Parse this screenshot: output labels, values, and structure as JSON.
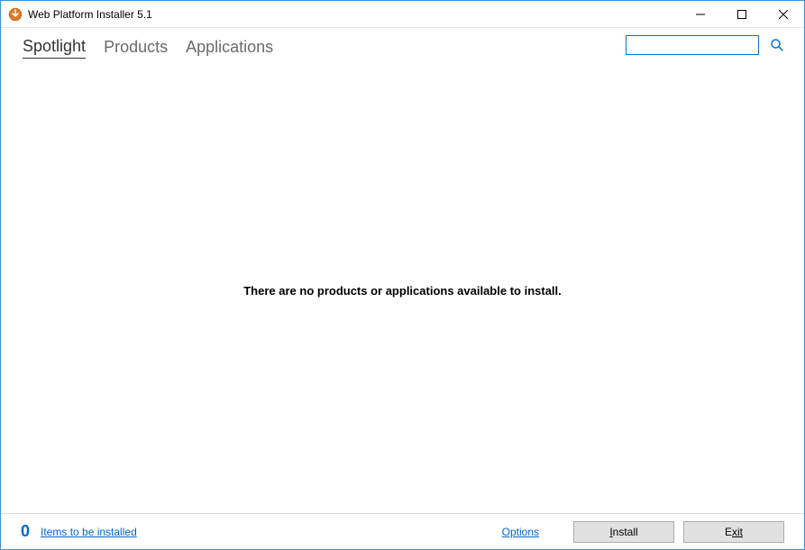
{
  "window": {
    "title": "Web Platform Installer 5.1"
  },
  "tabs": {
    "spotlight": "Spotlight",
    "products": "Products",
    "applications": "Applications"
  },
  "search": {
    "value": ""
  },
  "main": {
    "empty_message": "There are no products or applications available to install."
  },
  "footer": {
    "count": "0",
    "items_link": "Items to be installed",
    "options_link": "Options",
    "install_button_prefix": "I",
    "install_button_rest": "nstall",
    "exit_button_prefix": "E",
    "exit_button_rest": "xit"
  }
}
